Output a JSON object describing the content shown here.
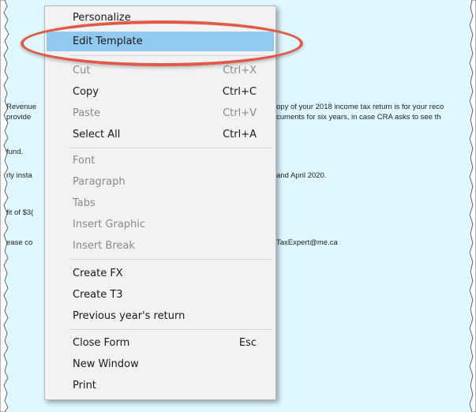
{
  "background_text": {
    "left": {
      "revenue": "Revenue",
      "provide": "provide",
      "fund": "fund.",
      "insta": "rly insta",
      "fit": "fit of $3(",
      "ease": "ease co"
    },
    "right": {
      "line1": "opy of your 2018 income tax return is for your reco",
      "line2": "cuments for six years, in case CRA asks to see th",
      "line3": "and April 2020.",
      "line4": "TaxExpert@me.ca"
    }
  },
  "context_menu": {
    "items": [
      {
        "label": "Personalize",
        "shortcut": "",
        "disabled": false
      },
      {
        "label": "Edit Template",
        "shortcut": "",
        "disabled": false,
        "highlighted": true
      },
      {
        "label": "Cut",
        "shortcut": "Ctrl+X",
        "disabled": true
      },
      {
        "label": "Copy",
        "shortcut": "Ctrl+C",
        "disabled": false
      },
      {
        "label": "Paste",
        "shortcut": "Ctrl+V",
        "disabled": true
      },
      {
        "label": "Select All",
        "shortcut": "Ctrl+A",
        "disabled": false
      },
      {
        "label": "Font",
        "shortcut": "",
        "disabled": true
      },
      {
        "label": "Paragraph",
        "shortcut": "",
        "disabled": true
      },
      {
        "label": "Tabs",
        "shortcut": "",
        "disabled": true
      },
      {
        "label": "Insert Graphic",
        "shortcut": "",
        "disabled": true
      },
      {
        "label": "Insert Break",
        "shortcut": "",
        "disabled": true
      },
      {
        "label": "Create FX",
        "shortcut": "",
        "disabled": false
      },
      {
        "label": "Create T3",
        "shortcut": "",
        "disabled": false
      },
      {
        "label": "Previous year's return",
        "shortcut": "",
        "disabled": false
      },
      {
        "label": "Close Form",
        "shortcut": "Esc",
        "disabled": false
      },
      {
        "label": "New Window",
        "shortcut": "",
        "disabled": false
      },
      {
        "label": "Print",
        "shortcut": "",
        "disabled": false
      }
    ]
  },
  "colors": {
    "document_bg": "#dff8ff",
    "menu_bg": "#f2f2f2",
    "highlight": "#92c9f0",
    "annotation_ring": "#e15a48"
  }
}
